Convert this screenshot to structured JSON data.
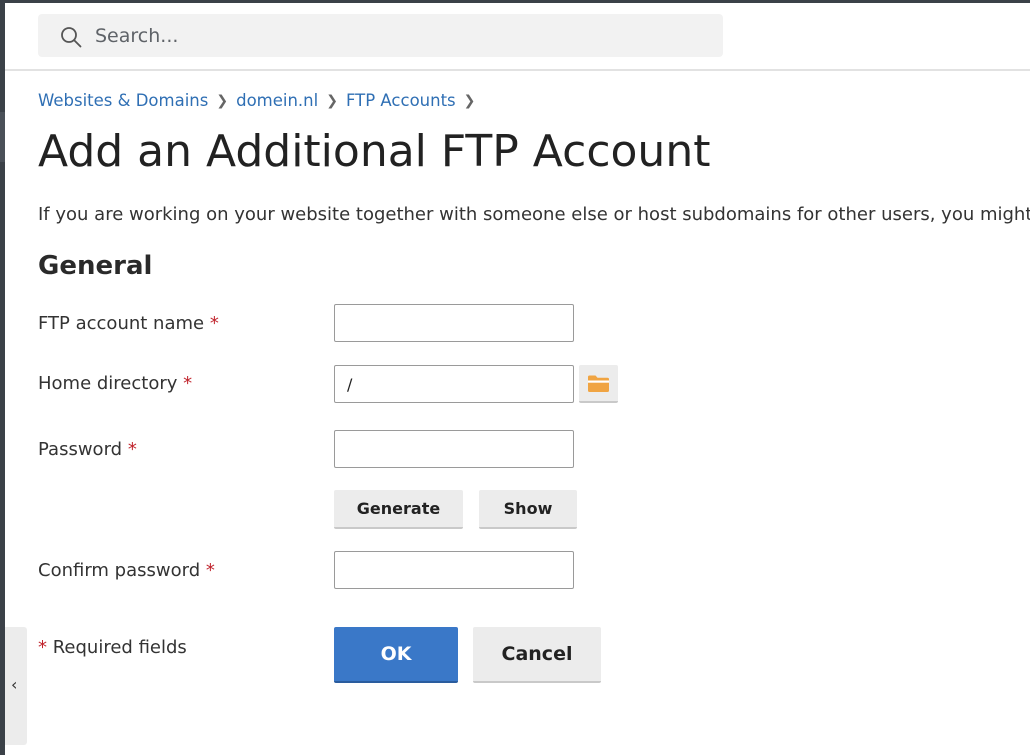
{
  "search": {
    "placeholder": "Search..."
  },
  "breadcrumb": [
    {
      "label": "Websites & Domains"
    },
    {
      "label": "domein.nl"
    },
    {
      "label": "FTP Accounts"
    }
  ],
  "page": {
    "title": "Add an Additional FTP Account",
    "description": "If you are working on your website together with someone else or host subdomains for other users, you might w"
  },
  "section": {
    "title": "General"
  },
  "form": {
    "required_marker": "*",
    "ftp_account_name": {
      "label": "FTP account name",
      "value": ""
    },
    "home_directory": {
      "label": "Home directory",
      "value": "/"
    },
    "password": {
      "label": "Password",
      "value": ""
    },
    "confirm_password": {
      "label": "Confirm password",
      "value": ""
    },
    "generate_label": "Generate",
    "show_label": "Show",
    "required_note": "Required fields",
    "ok_label": "OK",
    "cancel_label": "Cancel"
  },
  "side_toggle": {
    "glyph": "‹"
  },
  "icons": {
    "search": "search-icon",
    "folder": "folder-icon",
    "chevron_separator": "chevron-right-icon",
    "collapse": "chevron-left-icon"
  },
  "colors": {
    "link": "#2f6fb4",
    "primary_button": "#3a78c8",
    "required": "#c0232c",
    "folder": "#f0a442"
  }
}
